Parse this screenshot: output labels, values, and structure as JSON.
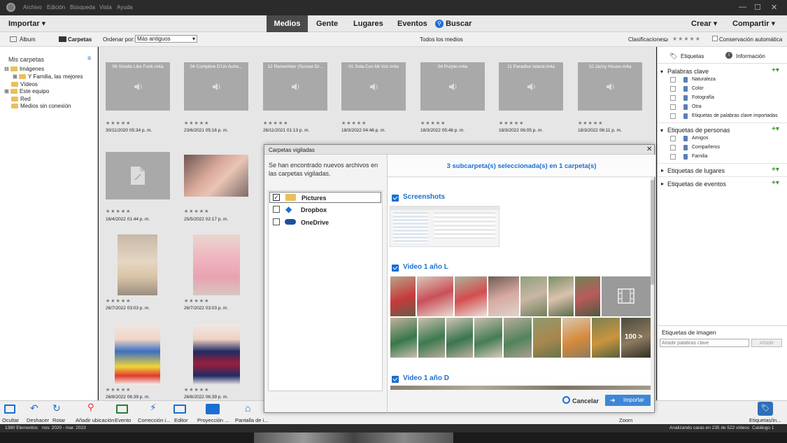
{
  "menu": [
    "Archivo",
    "Edición",
    "Búsqueda",
    "Vista",
    "Ayuda"
  ],
  "topbar": {
    "import_label": "Importar",
    "tabs": [
      "Medios",
      "Gente",
      "Lugares",
      "Eventos"
    ],
    "search_label": "Buscar",
    "create_label": "Crear",
    "share_label": "Compartir"
  },
  "viewbar": {
    "album_label": "Álbum",
    "folders_label": "Carpetas",
    "sort_label": "Ordenar por:",
    "sort_value": "Más antiguos",
    "center_label": "Todos los medios",
    "ratings_label": "Clasificaciones",
    "ratings_op": "≥",
    "autosave_label": "Conservación automática"
  },
  "left": {
    "title": "Mis carpetas",
    "items": [
      "Imágenes",
      "Y Familia, las mejores",
      "Vídeos",
      "Este equipo",
      "Red",
      "Medios sin conexión"
    ]
  },
  "grid": {
    "audio": [
      {
        "name": "06 Smells Like Funk.m4a",
        "date": "30/11/2020 05:34 p. m."
      },
      {
        "name": "04 Comptine D'Un Autre...",
        "date": "23/6/2021 05:16 p. m."
      },
      {
        "name": "12 Remember (Sunset Dr...",
        "date": "26/11/2021 01:13 p. m."
      },
      {
        "name": "01 Sola Con Mi Voz.m4a",
        "date": "18/3/2022 04:46 p. m."
      },
      {
        "name": "04 Purple.m4a",
        "date": "18/3/2022 05:46 p. m."
      },
      {
        "name": "11 Paradise Island.m4a",
        "date": "18/3/2022 06:05 p. m."
      },
      {
        "name": "10 Jazzy House.m4a",
        "date": "18/3/2022 06:11 p. m."
      }
    ],
    "row2_dates": [
      "16/4/2022 01:44 p. m.",
      "25/5/2022 02:17 p. m."
    ],
    "row3_dates": [
      "26/7/2022 03:03 p. m.",
      "26/7/2022 03:03 p. m."
    ],
    "row4_dates": [
      "26/8/2022 06:39 p. m.",
      "26/8/2022 06:39 p. m."
    ],
    "stars": "★★★★★"
  },
  "right": {
    "tab_tags": "Etiquetas",
    "tab_info": "Información",
    "keywords_title": "Palabras clave",
    "keywords": [
      "Naturaleza",
      "Color",
      "Fotografía",
      "Otra",
      "Etiquetas de palabras clave importadas"
    ],
    "people_title": "Etiquetas de personas",
    "people": [
      "Amigos",
      "Compañeros",
      "Familia"
    ],
    "places_title": "Etiquetas de lugares",
    "events_title": "Etiquetas de eventos",
    "image_tags_title": "Etiquetas de imagen",
    "image_tags_placeholder": "Añadir palabras clave",
    "add_label": "Añadir"
  },
  "dialog": {
    "title": "Carpetas vigiladas",
    "message": "Se han encontrado nuevos archivos en las carpetas vigiladas.",
    "selection": "3 subcarpeta(s) seleccionada(s) en 1 carpeta(s)",
    "sources": [
      {
        "label": "Pictures",
        "checked": true
      },
      {
        "label": "Dropbox",
        "checked": false
      },
      {
        "label": "OneDrive",
        "checked": false
      }
    ],
    "groups": [
      "Screenshots",
      "Video 1 año L",
      "Video 1 año D"
    ],
    "more_badge": "100 >",
    "cancel_label": "Cancelar",
    "import_label": "Importar"
  },
  "bottom": {
    "tools": [
      "Ocultar",
      "Deshacer",
      "Rotar",
      "Añadir ubicación",
      "Evento",
      "Corrección i...",
      "Editor",
      "Proyección ...",
      "Pantalla de i..."
    ],
    "zoom_label": "Zoom",
    "right_label": "Etiquetas/in..."
  },
  "status": {
    "count": "1380 Elementos",
    "range": "nov. 2020 - mar. 2023",
    "scan": "Analizando caras en 235 de 522 vídeos",
    "catalog": "Catálogo 1"
  },
  "colors": {
    "accent": "#1b6fd1",
    "dark_tab": "#4a4a4a",
    "audio_thumb": "#a9a9a9"
  }
}
